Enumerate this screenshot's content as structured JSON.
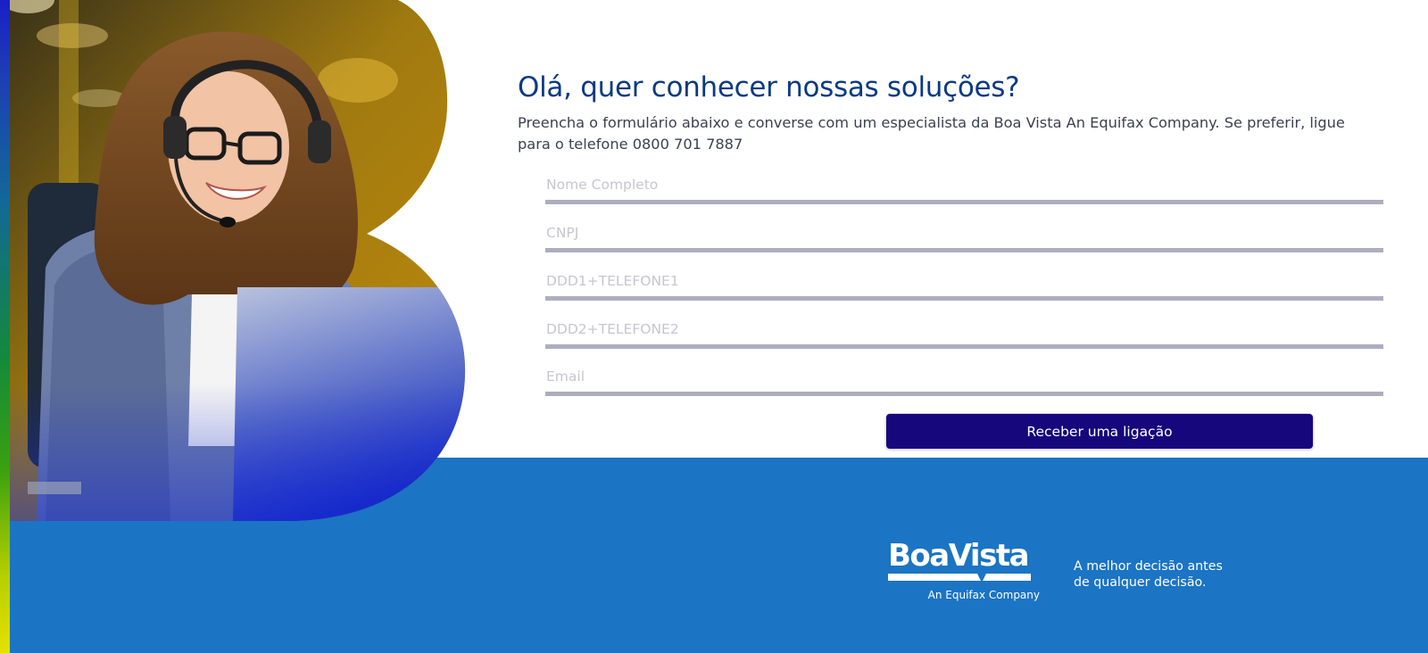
{
  "form": {
    "title": "Olá, quer conhecer nossas soluções?",
    "description": "Preencha o formulário abaixo e converse com um especialista da Boa Vista An Equifax Company. Se preferir, ligue para o telefone 0800 701 7887",
    "fields": [
      {
        "name": "nome-completo-input",
        "placeholder": "Nome Completo",
        "value": ""
      },
      {
        "name": "cnpj-input",
        "placeholder": "CNPJ",
        "value": ""
      },
      {
        "name": "telefone1-input",
        "placeholder": "DDD1+TELEFONE1",
        "value": ""
      },
      {
        "name": "telefone2-input",
        "placeholder": "DDD2+TELEFONE2",
        "value": ""
      },
      {
        "name": "email-input",
        "placeholder": "Email",
        "value": ""
      }
    ],
    "submit_label": "Receber uma ligação"
  },
  "footer": {
    "brand_name": "BoaVista",
    "brand_sub": "An Equifax Company",
    "tagline_line1": "A melhor decisão antes",
    "tagline_line2": "de qualquer decisão."
  },
  "colors": {
    "heading": "#0b3a82",
    "footer_band": "#1b74c4",
    "button": "#16077c",
    "input_underline": "#aeadc0"
  },
  "hero": {
    "description_icon": "agent-with-headset-photo"
  }
}
